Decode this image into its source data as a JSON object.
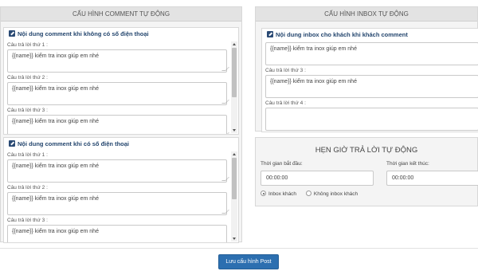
{
  "comment_panel": {
    "header": "CẤU HÌNH COMMENT TỰ ĐỘNG",
    "no_phone": {
      "title": "Nội dung comment khi không có số điện thoại",
      "replies": [
        {
          "label": "Câu trả lời thứ 1 :",
          "value": "{{name}} kiểm tra inox giúp em nhé"
        },
        {
          "label": "Câu trả lời thứ 2 :",
          "value": "{{name}} kiểm tra inox giúp em nhé"
        },
        {
          "label": "Câu trả lời thứ 3 :",
          "value": "{{name}} kiểm tra inox giúp em nhé"
        }
      ]
    },
    "with_phone": {
      "title": "Nội dung comment khi có số điện thoại",
      "replies": [
        {
          "label": "Câu trả lời thứ 1 :",
          "value": "{{name}} kiểm tra inox giúp em nhé"
        },
        {
          "label": "Câu trả lời thứ 2 :",
          "value": "{{name}} kiểm tra inox giúp em nhé"
        },
        {
          "label": "Câu trả lời thứ 3 :",
          "value": "{{name}} kiểm tra inox giúp em nhé"
        }
      ]
    }
  },
  "inbox_panel": {
    "header": "CẤU HÌNH INBOX TỰ ĐỘNG",
    "commenter": {
      "title": "Nội dung inbox cho khách khi khách comment",
      "replies": [
        {
          "label": "",
          "value": "{{name}} kiểm tra inox giúp em nhé"
        },
        {
          "label": "Câu trả lời thứ 3 :",
          "value": "{{name}} kiểm tra inox giúp em nhé"
        },
        {
          "label": "Câu trả lời thứ 4 :",
          "value": ""
        }
      ]
    }
  },
  "schedule_panel": {
    "title": "HẸN GIỜ TRẢ LỜI TỰ ĐỘNG",
    "start_label": "Thời gian bắt đầu:",
    "start_value": "00:00:00",
    "end_label": "Thời gian kết thúc:",
    "end_value": "00:00:00",
    "options": [
      {
        "label": "Inbox khách",
        "checked": true
      },
      {
        "label": "Không inbox khách",
        "checked": false
      }
    ]
  },
  "actions": {
    "save_label": "Lưu cấu hình Post"
  },
  "colors": {
    "primary_button": "#2c6fb0",
    "box_title": "#24466e"
  }
}
